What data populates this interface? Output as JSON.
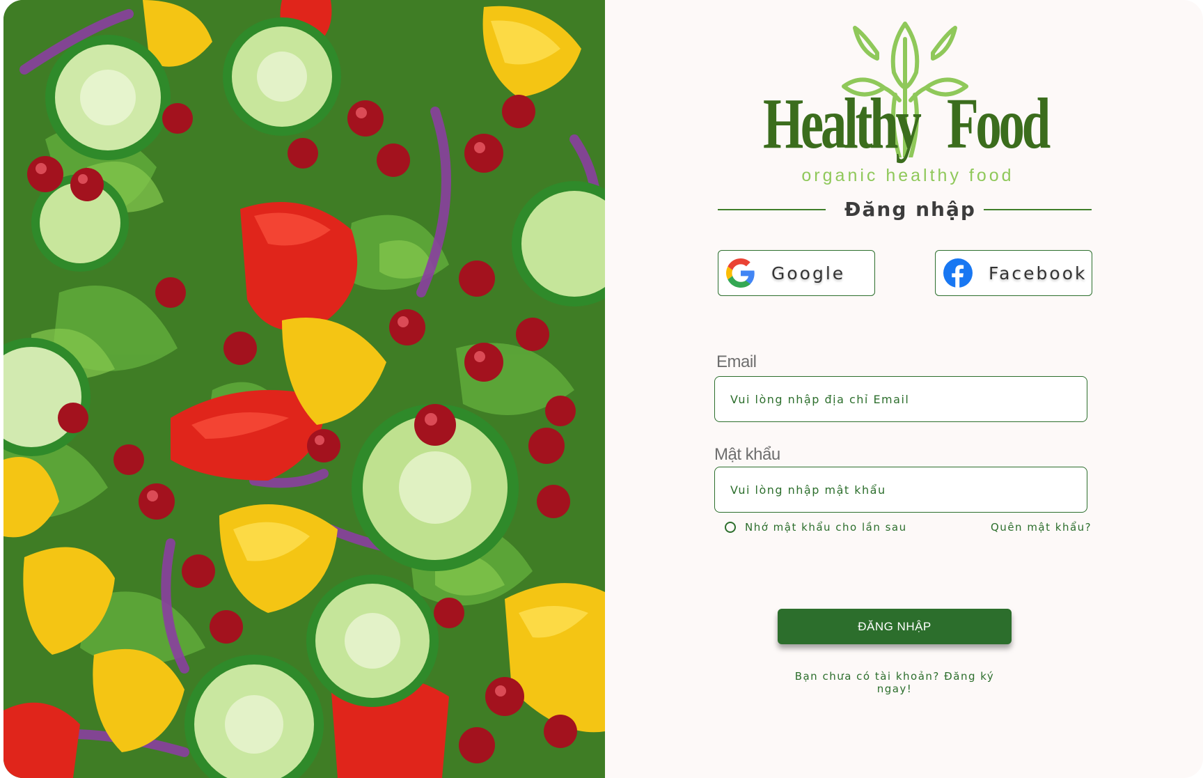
{
  "logo": {
    "word_left": "Healthy",
    "word_right": "Food",
    "tagline": "organic healthy food"
  },
  "login": {
    "heading": "Đăng nhập",
    "social": {
      "google_label": "Google",
      "facebook_label": "Facebook"
    },
    "email": {
      "label": "Email",
      "placeholder": "Vui lòng nhập địa chỉ Email"
    },
    "password": {
      "label": "Mật khẩu",
      "placeholder": "Vui lòng nhập mật khẩu"
    },
    "remember_label": "Nhớ mật khẩu cho lần sau",
    "forgot_label": "Quên mật khẩu?",
    "submit_label": "ĐĂNG NHẬP",
    "signup_prompt": "Bạn chưa có tài khoản? Đăng ký ngay!"
  },
  "colors": {
    "primary_green": "#2c6e2c",
    "logo_dark_green": "#3b6d1d",
    "logo_light_green": "#8fc85a",
    "background": "#fdf9f8"
  }
}
